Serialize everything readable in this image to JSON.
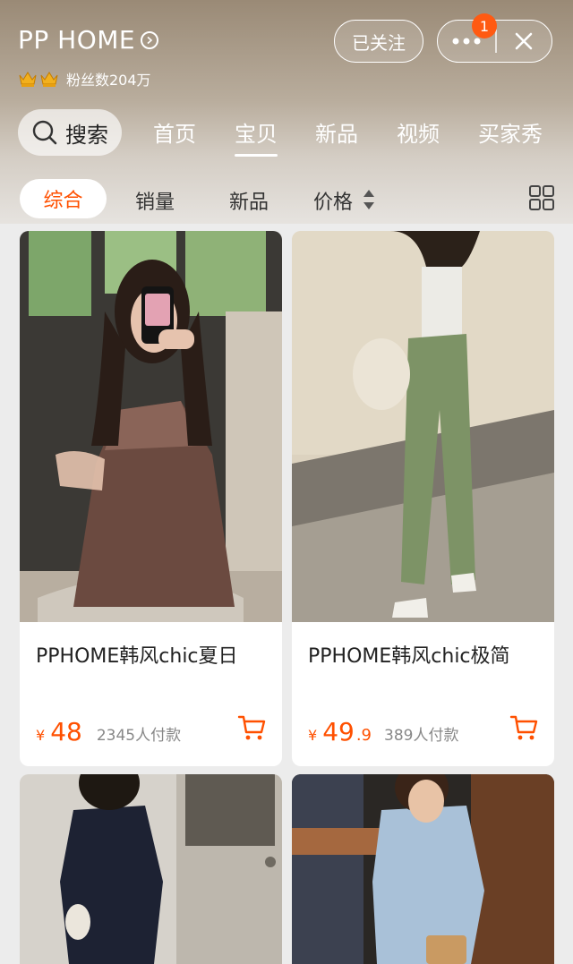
{
  "shop": {
    "title": "PP HOME",
    "fans_label": "粉丝数204万",
    "follow_label": "已关注",
    "badge_count": "1"
  },
  "search": {
    "label": "搜索"
  },
  "nav_tabs": [
    {
      "label": "首页"
    },
    {
      "label": "宝贝"
    },
    {
      "label": "新品"
    },
    {
      "label": "视频"
    },
    {
      "label": "买家秀"
    }
  ],
  "filters": {
    "active": "综合",
    "sales": "销量",
    "newest": "新品",
    "price": "价格"
  },
  "products": [
    {
      "name": "PPHOME韩风chic夏日",
      "price_int": "48",
      "price_dec": "",
      "sold": "2345人付款",
      "yen": "¥"
    },
    {
      "name": "PPHOME韩风chic极简",
      "price_int": "49",
      "price_dec": ".9",
      "sold": "389人付款",
      "yen": "¥"
    }
  ],
  "colors": {
    "accent": "#ff5000",
    "badge": "#ff5a12"
  }
}
